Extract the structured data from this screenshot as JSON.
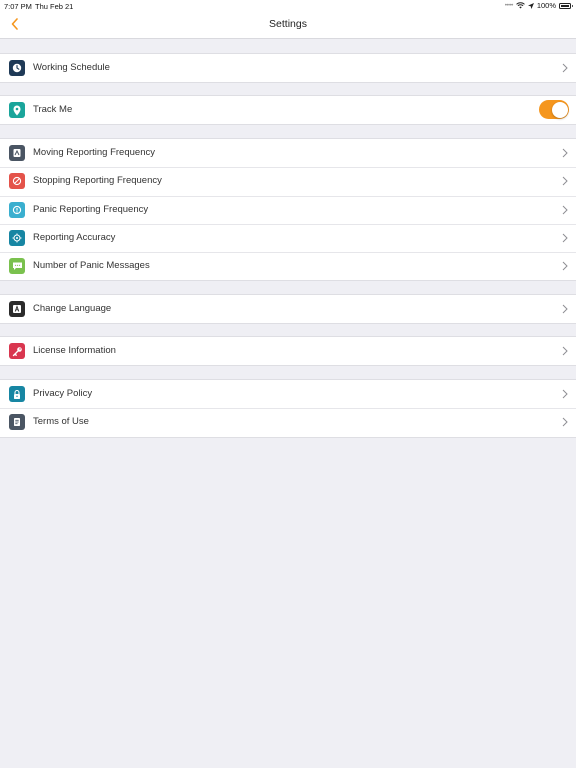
{
  "status_bar": {
    "time": "7:07 PM",
    "date": "Thu Feb 21",
    "battery": "100%"
  },
  "nav": {
    "title": "Settings",
    "back_icon": "chevron-left-icon"
  },
  "colors": {
    "accent": "#f5961e",
    "background": "#efeff4"
  },
  "sections": [
    {
      "items": [
        {
          "label": "Working Schedule",
          "icon": "clock-icon",
          "icon_color": "#1f3a57",
          "control": "chevron"
        }
      ]
    },
    {
      "items": [
        {
          "label": "Track Me",
          "icon": "location-pin-icon",
          "icon_color": "#1aa59b",
          "control": "toggle",
          "toggle_on": true
        }
      ]
    },
    {
      "items": [
        {
          "label": "Moving Reporting Frequency",
          "icon": "moving-icon",
          "icon_color": "#4a5563",
          "control": "chevron"
        },
        {
          "label": "Stopping Reporting Frequency",
          "icon": "stop-icon",
          "icon_color": "#e4534a",
          "control": "chevron"
        },
        {
          "label": "Panic Reporting Frequency",
          "icon": "panic-icon",
          "icon_color": "#3aafcf",
          "control": "chevron"
        },
        {
          "label": "Reporting Accuracy",
          "icon": "crosshair-icon",
          "icon_color": "#1786a3",
          "control": "chevron"
        },
        {
          "label": "Number of Panic Messages",
          "icon": "message-icon",
          "icon_color": "#7ac14e",
          "control": "chevron"
        }
      ]
    },
    {
      "items": [
        {
          "label": "Change Language",
          "icon": "language-icon",
          "icon_color": "#2b2b2b",
          "control": "chevron"
        }
      ]
    },
    {
      "items": [
        {
          "label": "License Information",
          "icon": "key-icon",
          "icon_color": "#d9364f",
          "control": "chevron"
        }
      ]
    },
    {
      "items": [
        {
          "label": "Privacy Policy",
          "icon": "lock-icon",
          "icon_color": "#1786a3",
          "control": "chevron"
        },
        {
          "label": "Terms of Use",
          "icon": "document-icon",
          "icon_color": "#4a5563",
          "control": "chevron"
        }
      ]
    }
  ]
}
